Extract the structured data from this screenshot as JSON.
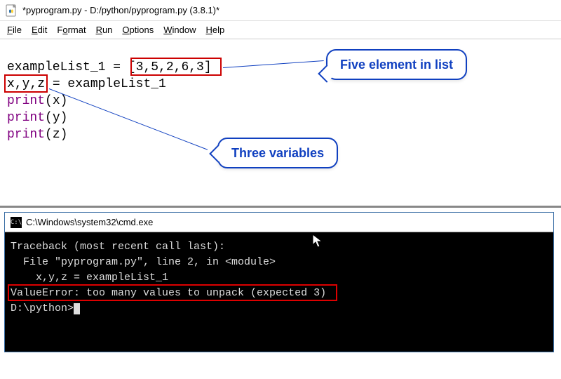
{
  "window": {
    "title": "*pyprogram.py - D:/python/pyprogram.py (3.8.1)*"
  },
  "menu": {
    "file": "File",
    "edit": "Edit",
    "format": "Format",
    "run": "Run",
    "options": "Options",
    "window": "Window",
    "help": "Help"
  },
  "code": {
    "l1_a": "exampleList_1 = ",
    "l1_b": "[3,5,2,6,3]",
    "l2_a": "x,y,z",
    "l2_b": " = exampleList_1",
    "l3_fn": "print",
    "l3_arg": "(x)",
    "l4_fn": "print",
    "l4_arg": "(y)",
    "l5_fn": "print",
    "l5_arg": "(z)"
  },
  "callouts": {
    "five": "Five element in list",
    "three": "Three variables"
  },
  "cmd": {
    "title": "C:\\Windows\\system32\\cmd.exe",
    "l1": "Traceback (most recent call last):",
    "l2": "  File \"pyprogram.py\", line 2, in <module>",
    "l3": "    x,y,z = exampleList_1",
    "l4": "ValueError: too many values to unpack (expected 3)",
    "l5": "",
    "prompt": "D:\\python>"
  }
}
